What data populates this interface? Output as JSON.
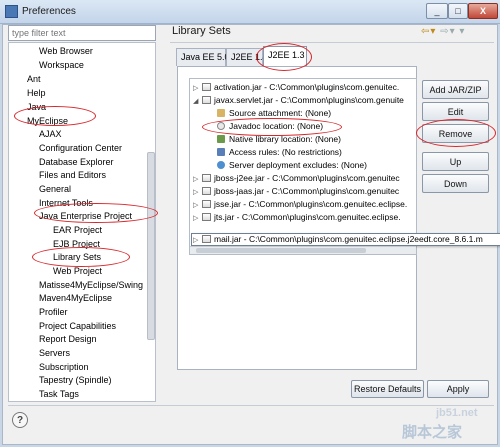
{
  "window": {
    "title": "Preferences",
    "minimize": "_",
    "maximize": "□",
    "close": "X"
  },
  "filter": {
    "placeholder": "type filter text"
  },
  "tree": [
    "Web Browser",
    "Workspace",
    "Ant",
    "Help",
    "Java",
    "MyEclipse",
    "AJAX",
    "Configuration Center",
    "Database Explorer",
    "Files and Editors",
    "General",
    "Internet Tools",
    "Java Enterprise Project",
    "EAR Project",
    "EJB Project",
    "Library Sets",
    "Web Project",
    "Matisse4MyEclipse/Swing",
    "Maven4MyEclipse",
    "Profiler",
    "Project Capabilities",
    "Report Design",
    "Servers",
    "Subscription",
    "Tapestry (Spindle)",
    "Task Tags"
  ],
  "page": {
    "title": "Library Sets",
    "nav_back": "⇦▾",
    "nav_fwd": "⇨▾",
    "menu": "▾"
  },
  "tabs": [
    "Java EE 5.0",
    "J2EE 1.4",
    "J2EE 1.3"
  ],
  "jars": [
    "activation.jar - C:\\Common\\plugins\\com.genuitec.",
    "javax.servlet.jar - C:\\Common\\plugins\\com.genuite",
    "Source attachment: (None)",
    "Javadoc location: (None)",
    "Native library location: (None)",
    "Access rules: (No restrictions)",
    "Server deployment excludes: (None)",
    "jboss-j2ee.jar - C:\\Common\\plugins\\com.genuitec",
    "jboss-jaas.jar - C:\\Common\\plugins\\com.genuitec",
    "jsse.jar - C:\\Common\\plugins\\com.genuitec.eclipse.",
    "jts.jar - C:\\Common\\plugins\\com.genuitec.eclipse.",
    "mail.jar - C:\\Common\\plugins\\com.genuitec.eclipse.j2eedt.core_8.6.1.m"
  ],
  "buttons": {
    "add": "Add JAR/ZIP",
    "edit": "Edit",
    "remove": "Remove",
    "up": "Up",
    "down": "Down",
    "restore": "Restore Defaults",
    "apply": "Apply"
  },
  "help_icon": "?",
  "watermark": {
    "line1": "jb51.net",
    "line2": "脚本之家"
  },
  "colors": {
    "annotation": "#d9262b",
    "window_bg": "#f0f0f0",
    "titlebar": "#c4d5ea"
  }
}
